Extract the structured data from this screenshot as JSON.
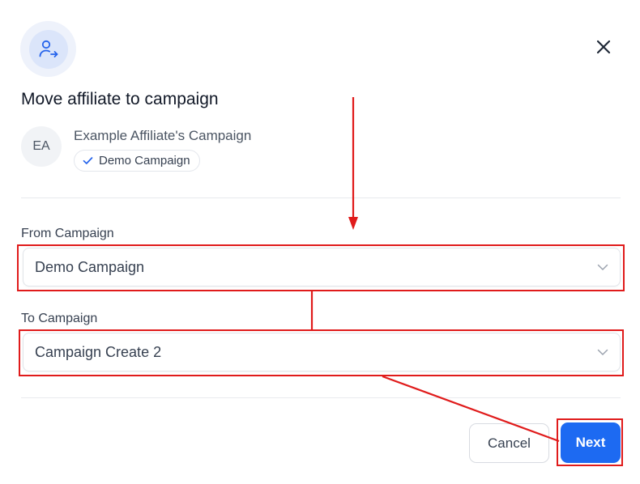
{
  "modal": {
    "title": "Move affiliate to campaign",
    "header_icon": "user-arrow-right-icon",
    "close_icon": "close-icon"
  },
  "affiliate": {
    "initials": "EA",
    "name": "Example Affiliate's Campaign",
    "campaign_badge": "Demo Campaign",
    "badge_icon": "check-icon"
  },
  "form": {
    "from_label": "From Campaign",
    "from_value": "Demo Campaign",
    "to_label": "To Campaign",
    "to_value": "Campaign Create 2",
    "dropdown_icon": "chevron-down-icon"
  },
  "actions": {
    "cancel_label": "Cancel",
    "next_label": "Next"
  },
  "colors": {
    "primary": "#1d6af2",
    "annotation": "#e01b1b",
    "icon_bg": "#dbe5fa"
  }
}
